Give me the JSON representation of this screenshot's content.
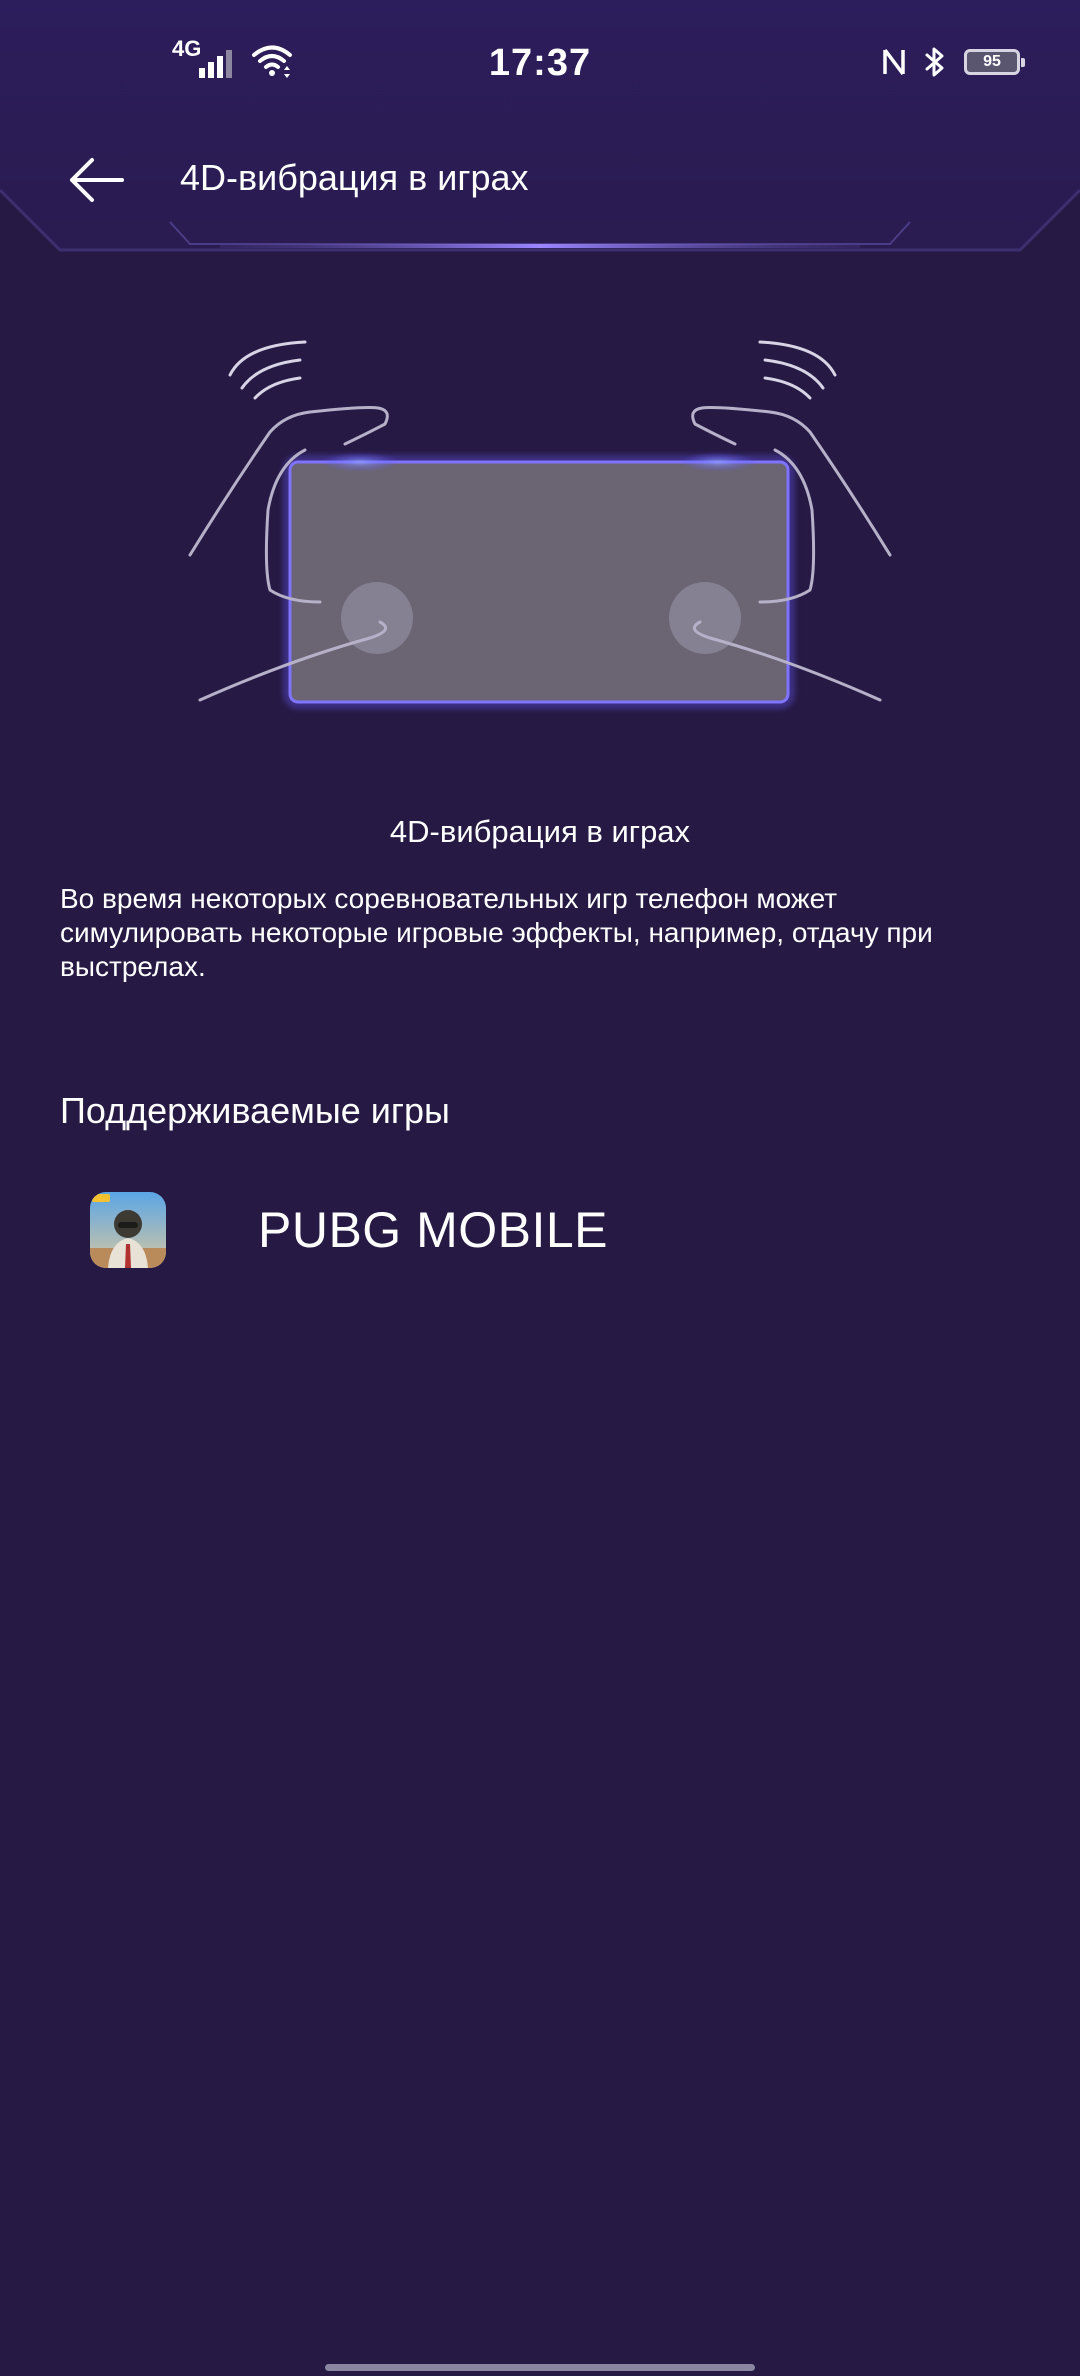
{
  "status_bar": {
    "network_type": "4G",
    "time": "17:37",
    "battery_level": "95",
    "icons": [
      "signal-icon",
      "wifi-icon",
      "nfc-icon",
      "bluetooth-icon",
      "battery-icon"
    ]
  },
  "header": {
    "title": "4D-вибрация в играх",
    "back_icon": "arrow-left-icon"
  },
  "feature": {
    "title": "4D-вибрация в играх",
    "description": "Во время некоторых соревновательных игр телефон может симулировать некоторые игровые эффекты, например, отдачу при выстрелах."
  },
  "supported": {
    "title": "Поддерживаемые игры",
    "games": [
      {
        "name": "PUBG MOBILE",
        "icon": "pubg-mobile-app-icon"
      }
    ]
  },
  "colors": {
    "background": "#261944",
    "header_gradient_top": "#2f1f5e",
    "phone_glow": "#5b4dff",
    "phone_fill": "#6b6573"
  }
}
